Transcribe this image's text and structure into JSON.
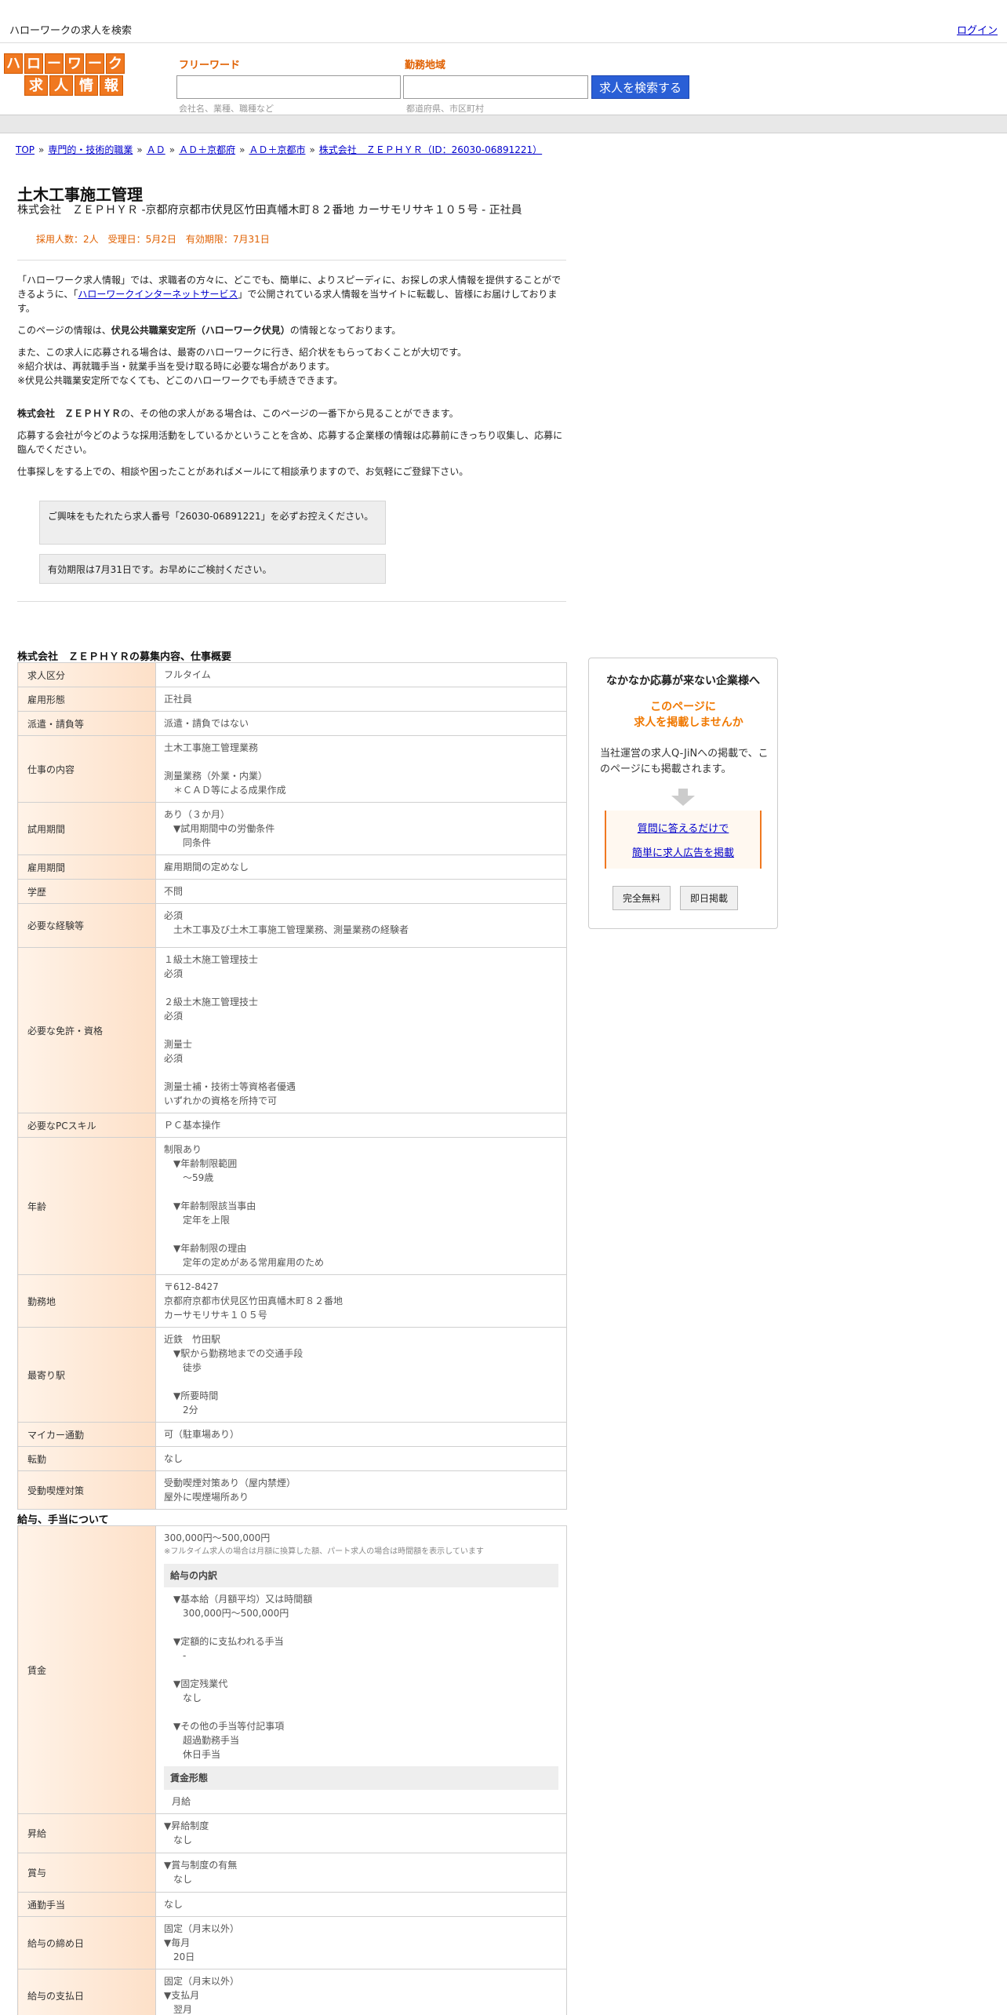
{
  "topbar": {
    "title": "ハローワークの求人を検索",
    "login": "ログイン"
  },
  "header": {
    "logo_row1": [
      "ハ",
      "ロ",
      "ー",
      "ワ",
      "ー",
      "ク"
    ],
    "logo_row2": [
      "求",
      "人",
      "情",
      "報"
    ],
    "freeword_label": "フリーワード",
    "area_label": "勤務地域",
    "freeword_hint": "会社名、業種、職種など",
    "area_hint": "都道府県、市区町村",
    "search_button": "求人を検索する",
    "accent": "#f07820",
    "button_color": "#2a5fd6"
  },
  "breadcrumb": {
    "items": [
      "TOP",
      "専門的・技術的職業",
      "ＡＤ",
      "ＡＤ＋京都府",
      "ＡＤ＋京都市",
      "株式会社　ＺＥＰＨＹＲ（ID：26030-06891221）"
    ],
    "sep": "»"
  },
  "job": {
    "title": "土木工事施工管理",
    "company_line": "株式会社　ＺＥＰＨＹＲ -京都府京都市伏見区竹田真幡木町８２番地 カーサモリサキ１０５号 - 正社員",
    "meta": "採用人数：2人　受理日：5月2日　有効期限：7月31日"
  },
  "intro": {
    "p1a": "「ハローワーク求人情報」では、求職者の方々に、どこでも、簡単に、よりスピーディに、お探しの求人情報を提供することができるように、「",
    "p1link": "ハローワークインターネットサービス",
    "p1b": "」で公開されている求人情報を当サイトに転載し、皆様にお届けしております。",
    "p2a": "このページの情報は、",
    "p2bold": "伏見公共職業安定所（ハローワーク伏見）",
    "p2b": "の情報となっております。",
    "p3": "また、この求人に応募される場合は、最寄のハローワークに行き、紹介状をもらっておくことが大切です。",
    "p3b": "※紹介状は、再就職手当・就業手当を受け取る時に必要な場合があります。",
    "p3c": "※伏見公共職業安定所でなくても、どこのハローワークでも手続きできます。",
    "p4bold": "株式会社　ＺＥＰＨＹＲ",
    "p4": "の、その他の求人がある場合は、このページの一番下から見ることができます。",
    "p5": "応募する会社が今どのような採用活動をしているかということを含め、応募する企業様の情報は応募前にきっちり収集し、応募に臨んでください。",
    "p6": "仕事探しをする上での、相談や困ったことがあればメールにて相談承りますので、お気軽にご登録下さい。"
  },
  "notes": {
    "n1": "ご興味をもたれたら求人番号「26030-06891221」を必ずお控えください。",
    "n2": "有効期限は7月31日です。お早めにご検討ください。"
  },
  "section1": {
    "title": "株式会社　ＺＥＰＨＹＲの募集内容、仕事概要",
    "rows": [
      {
        "k": "求人区分",
        "v": "フルタイム"
      },
      {
        "k": "雇用形態",
        "v": "正社員"
      },
      {
        "k": "派遣・請負等",
        "v": "派遣・請負ではない"
      },
      {
        "k": "仕事の内容",
        "v": "土木工事施工管理業務\n\n測量業務（外業・内業）\n　＊ＣＡＤ等による成果作成"
      },
      {
        "k": "試用期間",
        "v": "あり（３か月）\n　▼試用期間中の労働条件\n　　同条件"
      },
      {
        "k": "雇用期間",
        "v": "雇用期間の定めなし"
      },
      {
        "k": "学歴",
        "v": "不問"
      },
      {
        "k": "必要な経験等",
        "v": "必須\n　土木工事及び土木工事施工管理業務、測量業務の経験者"
      },
      {
        "k": "必要な免許・資格",
        "v": "１級土木施工管理技士\n必須\n\n２級土木施工管理技士\n必須\n\n測量士\n必須\n\n測量士補・技術士等資格者優遇\nいずれかの資格を所持で可"
      },
      {
        "k": "必要なPCスキル",
        "v": "ＰＣ基本操作"
      },
      {
        "k": "年齢",
        "v": "制限あり\n　▼年齢制限範囲\n　　〜59歳\n\n　▼年齢制限該当事由\n　　定年を上限\n\n　▼年齢制限の理由\n　　定年の定めがある常用雇用のため"
      },
      {
        "k": "勤務地",
        "v": "〒612-8427\n京都府京都市伏見区竹田真幡木町８２番地\nカーサモリサキ１０５号"
      },
      {
        "k": "最寄り駅",
        "v": "近鉄　竹田駅\n　▼駅から勤務地までの交通手段\n　　徒歩\n\n　▼所要時間\n　　2分"
      },
      {
        "k": "マイカー通勤",
        "v": "可（駐車場あり）"
      },
      {
        "k": "転勤",
        "v": "なし"
      },
      {
        "k": "受動喫煙対策",
        "v": "受動喫煙対策あり（屋内禁煙）\n屋外に喫煙場所あり"
      }
    ]
  },
  "section2": {
    "title": "給与、手当について",
    "wage_label": "賃金",
    "wage_range": "300,000円〜500,000円",
    "wage_note": "※フルタイム求人の場合は月額に換算した額、パート求人の場合は時間額を表示しています",
    "breakdown_title": "給与の内訳",
    "breakdown": "　▼基本給（月額平均）又は時間額\n　　300,000円〜500,000円\n\n　▼定額的に支払われる手当\n　　-\n\n　▼固定残業代\n　　なし\n\n　▼その他の手当等付記事項\n　　超過勤務手当\n　　休日手当",
    "wage_form_title": "賃金形態",
    "wage_form": "月給",
    "rows": [
      {
        "k": "昇給",
        "v": "▼昇給制度\n　なし"
      },
      {
        "k": "賞与",
        "v": "▼賞与制度の有無\n　なし"
      },
      {
        "k": "通勤手当",
        "v": "なし"
      },
      {
        "k": "給与の締め日",
        "v": "固定（月末以外）\n▼毎月\n　20日"
      },
      {
        "k": "給与の支払日",
        "v": "固定（月末以外）\n▼支払月\n　翌月"
      }
    ]
  },
  "ad": {
    "heading": "なかなか応募が来ない企業様へ",
    "offer1": "このページに",
    "offer2": "　求人を掲載しませんか",
    "desc": "当社運営の求人Q-JiNへの掲載で、このページにも掲載されます。",
    "link1": "質問に答えるだけで",
    "link2": "簡単に求人広告を掲載",
    "btn1": "完全無料",
    "btn2": "即日掲載"
  }
}
